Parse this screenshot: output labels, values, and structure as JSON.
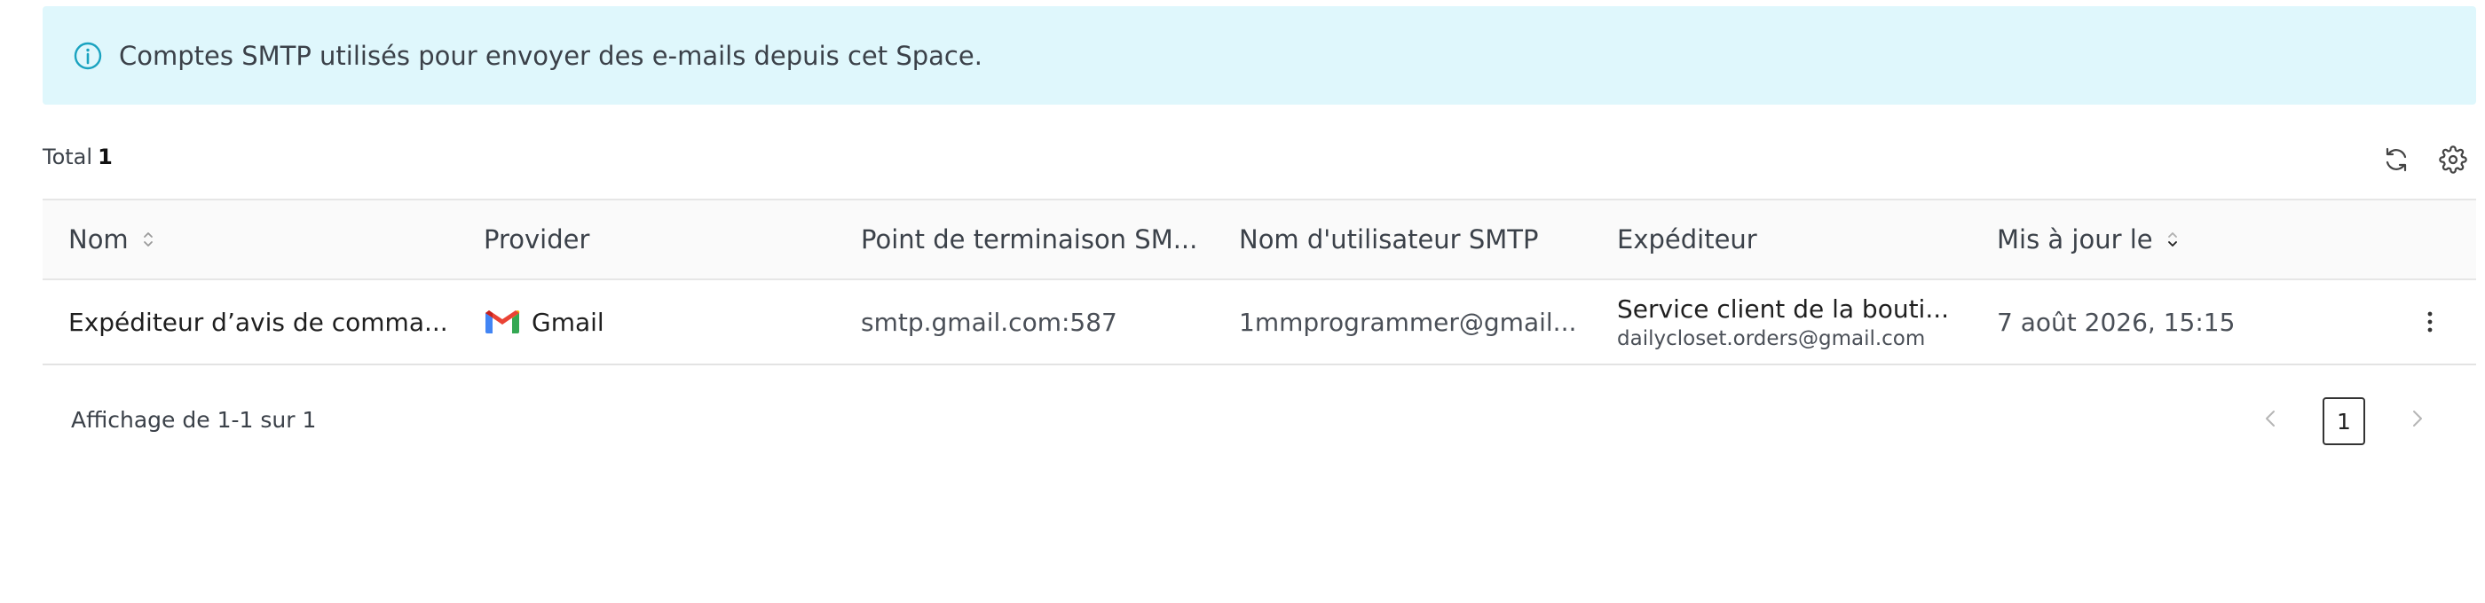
{
  "banner": {
    "text": "Comptes SMTP utilisés pour envoyer des e-mails depuis cet Space.",
    "icon": "info-icon"
  },
  "summary": {
    "total_label": "Total",
    "total_value": "1"
  },
  "toolbar": {
    "refresh_icon": "refresh-icon",
    "settings_icon": "gear-icon"
  },
  "table": {
    "headers": {
      "name": "Nom",
      "provider": "Provider",
      "endpoint": "Point de terminaison SM...",
      "username": "Nom d'utilisateur SMTP",
      "sender": "Expéditeur",
      "updated": "Mis à jour le"
    },
    "rows": [
      {
        "name": "Expéditeur d’avis de comma...",
        "provider": "Gmail",
        "endpoint": "smtp.gmail.com:587",
        "username": "1mmprogrammer@gmail...",
        "sender_name": "Service client de la bouti...",
        "sender_email": "dailycloset.orders@gmail.com",
        "updated": "7 août 2026, 15:15"
      }
    ]
  },
  "pagination": {
    "summary": "Affichage de 1-1 sur 1",
    "current_page": "1"
  },
  "colors": {
    "banner_bg": "#dff7fc",
    "info_accent": "#1aa3c0",
    "header_bg": "#fafafa"
  }
}
